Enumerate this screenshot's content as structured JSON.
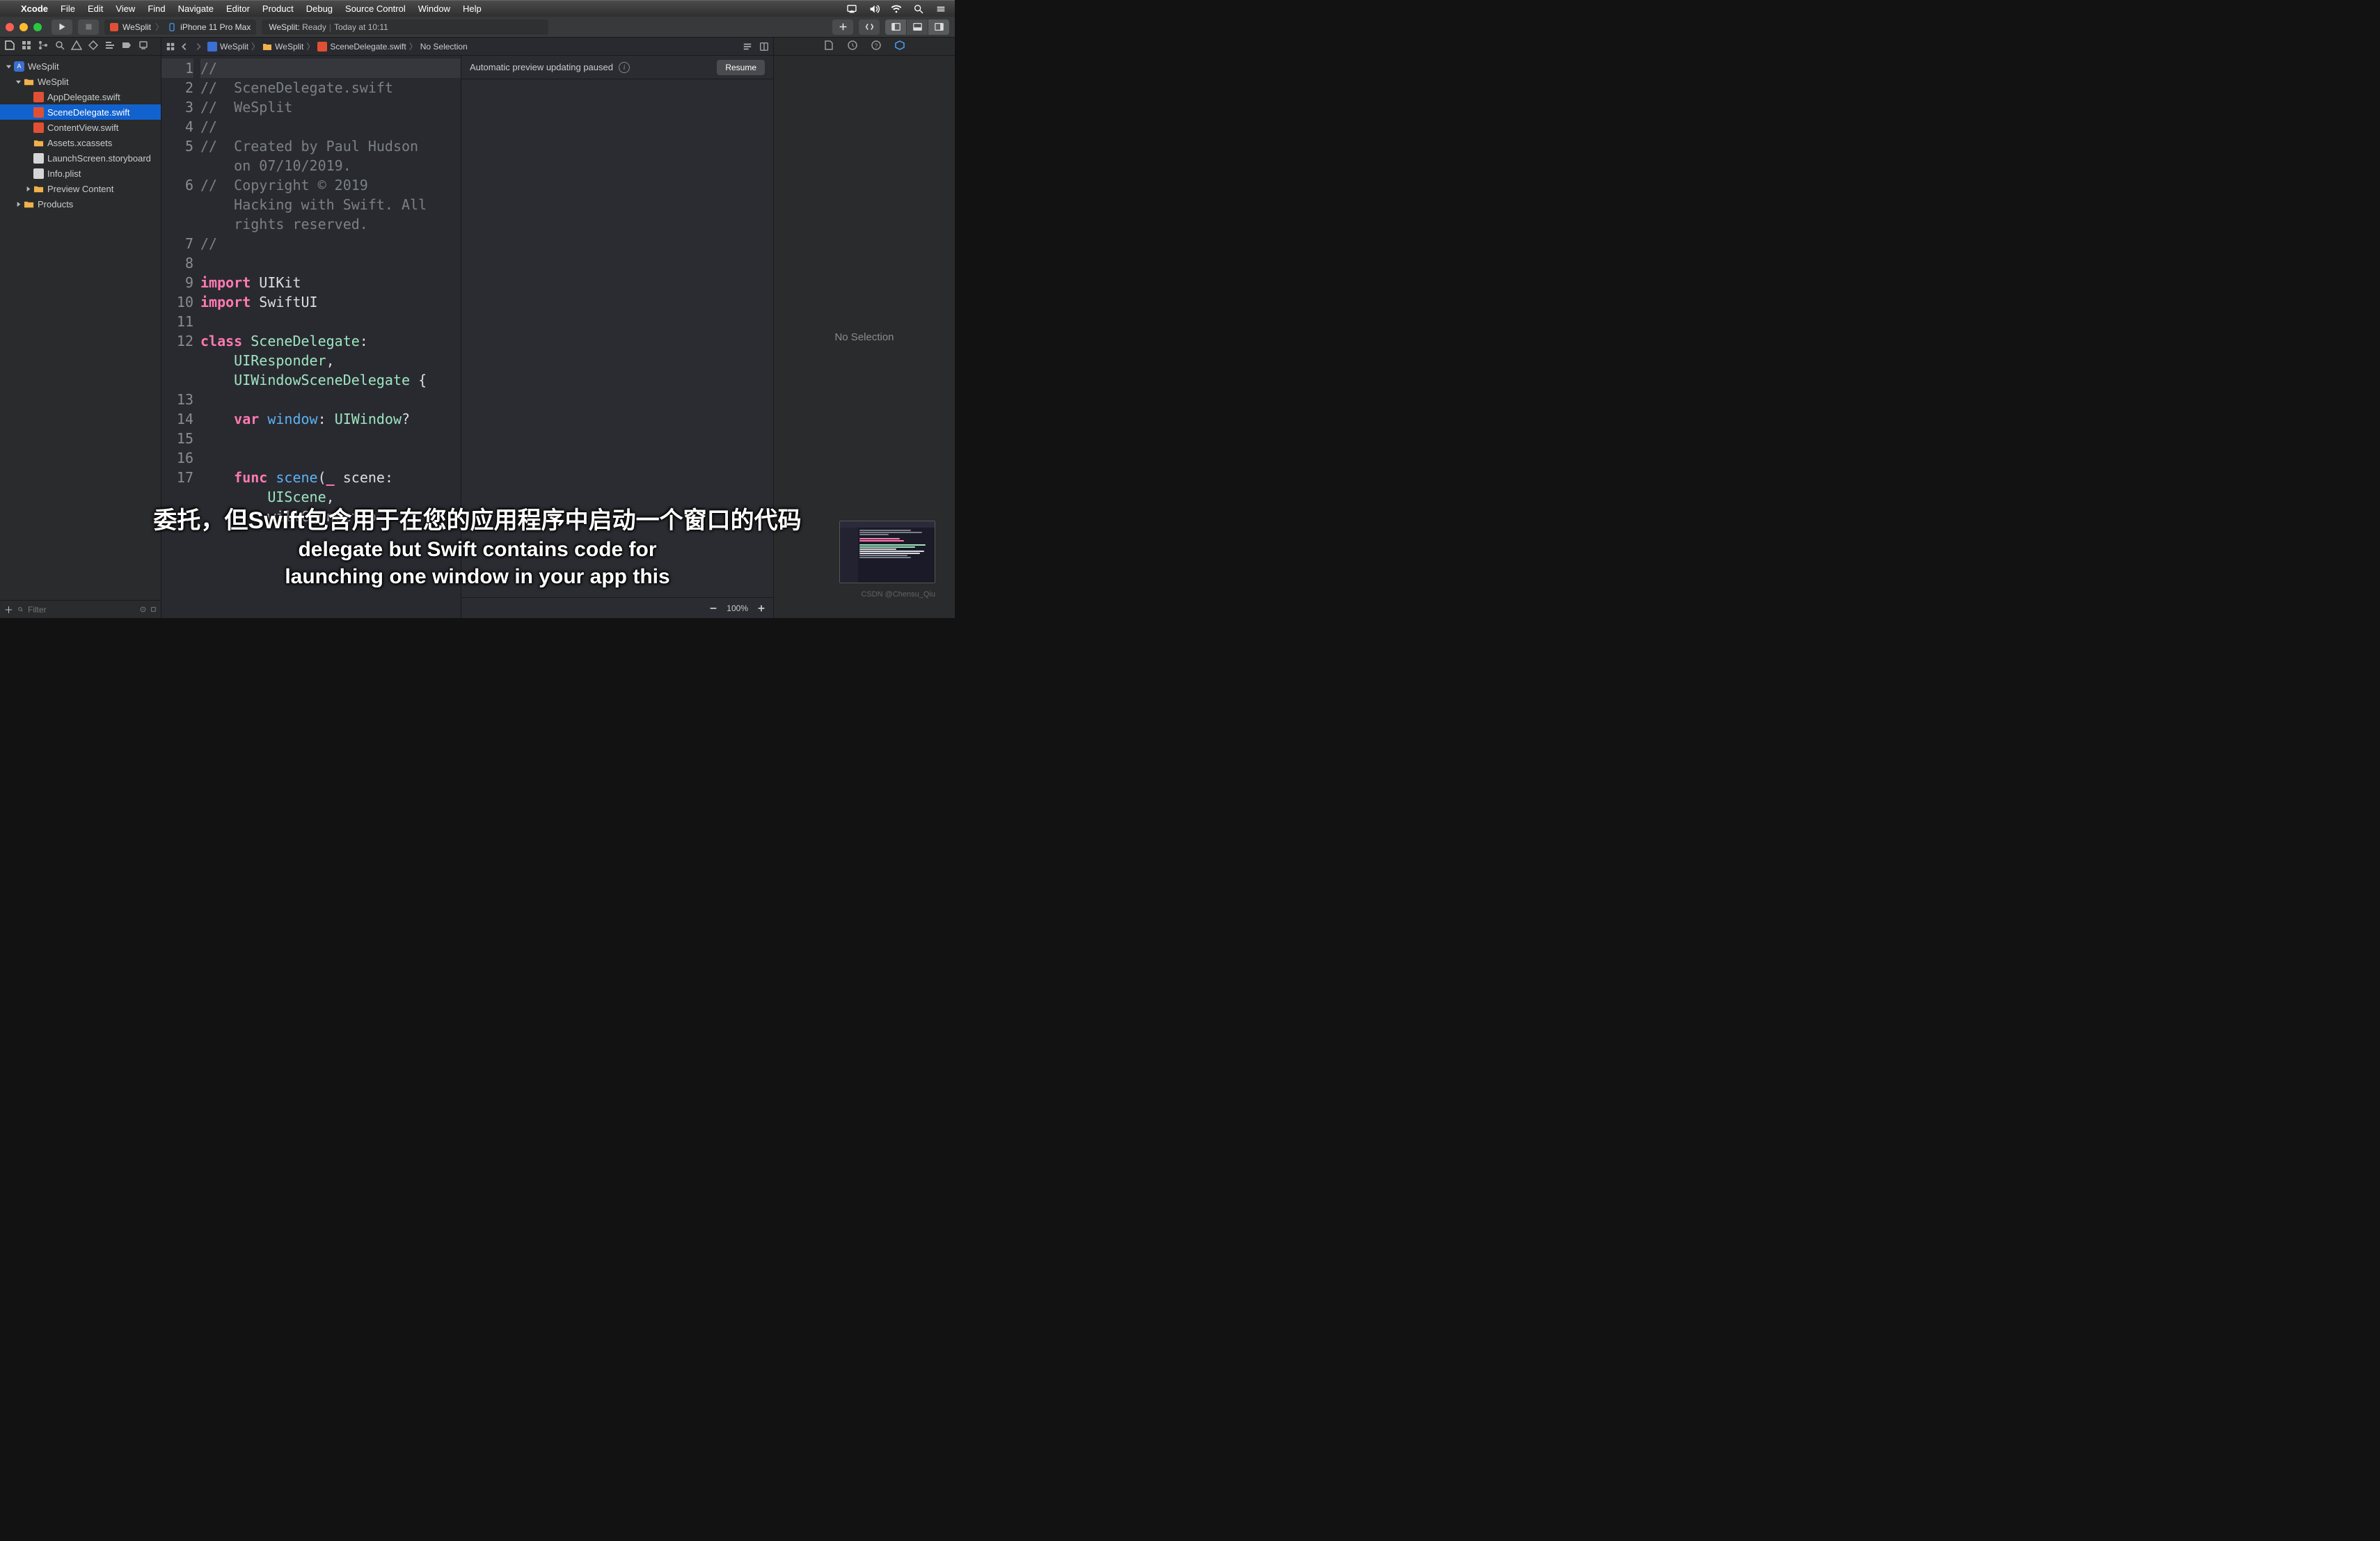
{
  "menubar": {
    "app": "Xcode",
    "items": [
      "File",
      "Edit",
      "View",
      "Find",
      "Navigate",
      "Editor",
      "Product",
      "Debug",
      "Source Control",
      "Window",
      "Help"
    ]
  },
  "toolbar": {
    "scheme_app": "WeSplit",
    "scheme_dest": "iPhone 11 Pro Max",
    "activity_project": "WeSplit:",
    "activity_status": "Ready",
    "activity_time": "Today at 10:11"
  },
  "navigator": {
    "filter_placeholder": "Filter",
    "tree": {
      "root": "WeSplit",
      "group": "WeSplit",
      "files": [
        {
          "name": "AppDelegate.swift",
          "kind": "swift"
        },
        {
          "name": "SceneDelegate.swift",
          "kind": "swift",
          "selected": true
        },
        {
          "name": "ContentView.swift",
          "kind": "swift"
        },
        {
          "name": "Assets.xcassets",
          "kind": "assets"
        },
        {
          "name": "LaunchScreen.storyboard",
          "kind": "story"
        },
        {
          "name": "Info.plist",
          "kind": "plist"
        }
      ],
      "folders": [
        "Preview Content",
        "Products"
      ]
    }
  },
  "jumpbar": {
    "crumbs": [
      "WeSplit",
      "WeSplit",
      "SceneDelegate.swift",
      "No Selection"
    ]
  },
  "code": {
    "lines": [
      {
        "n": 1,
        "t": "//",
        "cls": "c",
        "hl": true
      },
      {
        "n": 2,
        "t": "//  SceneDelegate.swift",
        "cls": "c"
      },
      {
        "n": 3,
        "t": "//  WeSplit",
        "cls": "c"
      },
      {
        "n": 4,
        "t": "//",
        "cls": "c"
      },
      {
        "n": 5,
        "t": "//  Created by Paul Hudson \n    on 07/10/2019.",
        "cls": "c"
      },
      {
        "n": 6,
        "t": "//  Copyright © 2019 \n    Hacking with Swift. All \n    rights reserved.",
        "cls": "c"
      },
      {
        "n": 7,
        "t": "//",
        "cls": "c"
      },
      {
        "n": 8,
        "t": "",
        "cls": ""
      },
      {
        "n": 9,
        "segs": [
          {
            "t": "import ",
            "c": "c-kw"
          },
          {
            "t": "UIKit",
            "c": "c-frame"
          }
        ]
      },
      {
        "n": 10,
        "segs": [
          {
            "t": "import ",
            "c": "c-kw"
          },
          {
            "t": "SwiftUI",
            "c": "c-frame"
          }
        ]
      },
      {
        "n": 11,
        "t": "",
        "cls": ""
      },
      {
        "n": 12,
        "segs": [
          {
            "t": "class ",
            "c": "c-kw"
          },
          {
            "t": "SceneDelegate",
            "c": "c-type"
          },
          {
            "t": ": \n    ",
            "c": ""
          },
          {
            "t": "UIResponder",
            "c": "c-type"
          },
          {
            "t": ", \n    ",
            "c": ""
          },
          {
            "t": "UIWindowSceneDelegate",
            "c": "c-type"
          },
          {
            "t": " {",
            "c": ""
          }
        ]
      },
      {
        "n": 13,
        "t": "",
        "cls": ""
      },
      {
        "n": 14,
        "segs": [
          {
            "t": "    ",
            "c": ""
          },
          {
            "t": "var ",
            "c": "c-kw"
          },
          {
            "t": "window",
            "c": "c-var"
          },
          {
            "t": ": ",
            "c": ""
          },
          {
            "t": "UIWindow",
            "c": "c-type"
          },
          {
            "t": "?",
            "c": ""
          }
        ]
      },
      {
        "n": 15,
        "t": "",
        "cls": ""
      },
      {
        "n": 16,
        "t": "",
        "cls": ""
      },
      {
        "n": 17,
        "segs": [
          {
            "t": "    ",
            "c": ""
          },
          {
            "t": "func ",
            "c": "c-kw"
          },
          {
            "t": "scene",
            "c": "c-var"
          },
          {
            "t": "(",
            "c": ""
          },
          {
            "t": "_",
            "c": "c-kw"
          },
          {
            "t": " scene: \n        ",
            "c": ""
          },
          {
            "t": "UIScene",
            "c": "c-type"
          },
          {
            "t": ", \n        willConnectTo",
            "c": ""
          }
        ]
      }
    ]
  },
  "preview": {
    "message": "Automatic preview updating paused",
    "resume": "Resume",
    "zoom": "100%"
  },
  "inspector": {
    "empty_label": "No Selection"
  },
  "captions": {
    "zh": "委托，但Swift包含用于在您的应用程序中启动一个窗口的代码",
    "en1": "delegate but Swift contains code for",
    "en2": "launching one window in your app this"
  },
  "watermark": "CSDN @Chensu_Qiu"
}
